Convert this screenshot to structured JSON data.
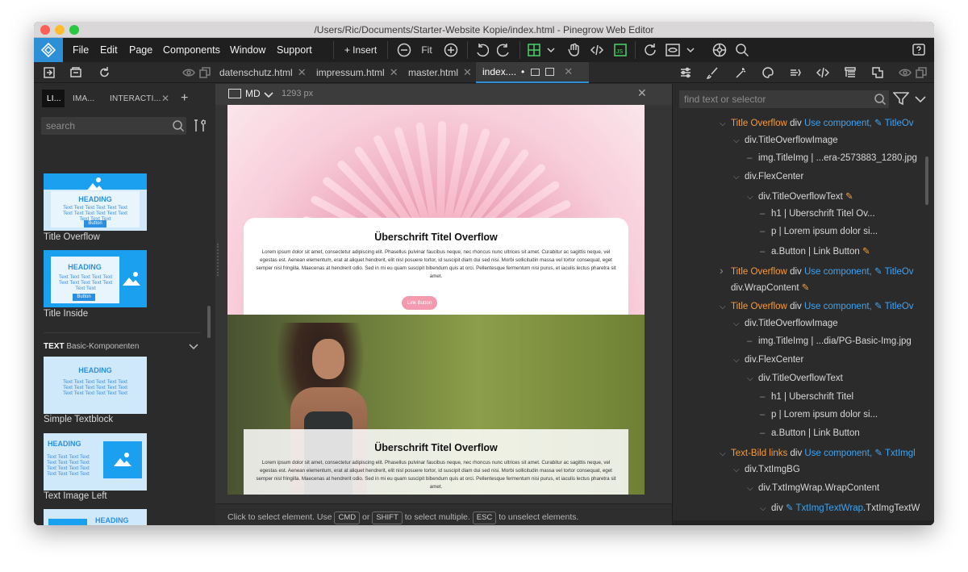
{
  "window": {
    "title": "/Users/Ric/Documents/Starter-Website Kopie/index.html - Pinegrow Web Editor"
  },
  "menu": [
    "File",
    "Edit",
    "Page",
    "Components",
    "Window",
    "Support"
  ],
  "toolbar": {
    "insert": "+ Insert",
    "fit": "Fit"
  },
  "tabs": [
    {
      "label": "datenschutz.html"
    },
    {
      "label": "impressum.html"
    },
    {
      "label": "master.html"
    },
    {
      "label": "index...."
    }
  ],
  "left_panel": {
    "tabs": [
      "LI...",
      "IMA...",
      "INTERACTI..."
    ],
    "search_placeholder": "search",
    "cards": [
      {
        "label": "Title Overflow",
        "heading": "HEADING",
        "text": "Text Text Text Text Text Text Text Text Text Text Text Text Text Text Text",
        "button": "Button"
      },
      {
        "label": "Title Inside",
        "heading": "HEADING",
        "text": "Text Text Text Text Text Text Text Text Text Text Text Text",
        "button": "Button"
      },
      {
        "label": "Simple Textblock",
        "heading": "HEADING",
        "text": "Text Text Text Text Text Text Text Text Text Text Text Text Text Text Text Text Text Text"
      },
      {
        "label": "Text Image Left",
        "heading": "HEADING",
        "text": "Text Text Text Text Text Text Text Text Text Text Text Text Text Text Text Text"
      },
      {
        "label": "",
        "heading": "HEADING"
      }
    ],
    "section": {
      "bold": "TEXT",
      "rest": "Basic-Komponenten"
    }
  },
  "center": {
    "device": "MD",
    "width": "1293 px",
    "heading1": "Überschrift Titel Overflow",
    "heading2": "Überschrift Titel Overflow",
    "lorem": "Lorem ipsum dolor sit amet, consectetur adipiscing elit. Phasellus pulvinar faucibus neque, nec rhoncus nunc ultrices sit amet. Curabitur ac sagittis neque, vel egestas est. Aenean elementum, erat at aliquet hendrerit, elit nisl posuere tortor, id suscipit diam dui sed nisi. Morbi sollicitudin massa vel tortor consequat, eget semper nisl fringilla. Maecenas at hendrerit odio. Sed in mi eu quam suscipit bibendum quis at orci. Pellentesque fermentum nisi purus, et iaculis lectus pharetra sit amet.",
    "link_button": "Link Button"
  },
  "status": {
    "t1": "Click to select element. Use",
    "k1": "CMD",
    "t2": "or",
    "k2": "SHIFT",
    "t3": "to select multiple.",
    "k3": "ESC",
    "t4": "to unselect elements."
  },
  "right_panel": {
    "search_placeholder": "find text or selector",
    "tree": [
      {
        "arrow": "v",
        "name": "Title Overflow",
        "tag": "div",
        "extra": "Use component,",
        "comp": "TitleOv"
      },
      {
        "arrow": "v",
        "text": "div.TitleOverflowImage"
      },
      {
        "arrow": "-",
        "text": "img.TitleImg | ...era-2573883_1280.jpg"
      },
      {
        "arrow": "v",
        "text": "div.FlexCenter"
      },
      {
        "arrow": "v",
        "text": "div.TitleOverflowText",
        "edit": true
      },
      {
        "arrow": "-",
        "text": "h1 | Überschrift Titel Ov..."
      },
      {
        "arrow": "-",
        "text": "p | Lorem ipsum dolor si..."
      },
      {
        "arrow": "-",
        "text": "a.Button | Link Button",
        "edit": true
      },
      {
        "arrow": ">",
        "name": "Title Overflow",
        "tag": "div",
        "extra": "Use component,",
        "comp": "TitleOv"
      },
      {
        "arrow": "",
        "text": "div.WrapContent",
        "edit": true
      },
      {
        "arrow": "v",
        "name": "Title Overflow",
        "tag": "div",
        "extra": "Use component,",
        "comp": "TitleOv"
      },
      {
        "arrow": "v",
        "text": "div.TitleOverflowImage"
      },
      {
        "arrow": "-",
        "text": "img.TitleImg | ...dia/PG-Basic-Img.jpg"
      },
      {
        "arrow": "v",
        "text": "div.FlexCenter"
      },
      {
        "arrow": "v",
        "text": "div.TitleOverflowText"
      },
      {
        "arrow": "-",
        "text": "h1 | Überschrift Titel"
      },
      {
        "arrow": "-",
        "text": "p | Lorem ipsum dolor si..."
      },
      {
        "arrow": "-",
        "text": "a.Button | Link Button"
      },
      {
        "arrow": "v",
        "name": "Text-Bild links",
        "tag": "div",
        "extra": "Use component,",
        "comp": "TxtImgl"
      },
      {
        "arrow": "v",
        "text": "div.TxtImgBG"
      },
      {
        "arrow": "v",
        "text": "div.TxtImgWrap.WrapContent"
      },
      {
        "arrow": "v",
        "text": "div",
        "comp": "TxtImgTextWrap",
        "tail": ".TxtImgTextW"
      }
    ]
  },
  "colors": {
    "accent": "#2d8fd6",
    "orange": "#f49b3a",
    "blue": "#3da3f2",
    "pink_button": "#f39aaf"
  }
}
